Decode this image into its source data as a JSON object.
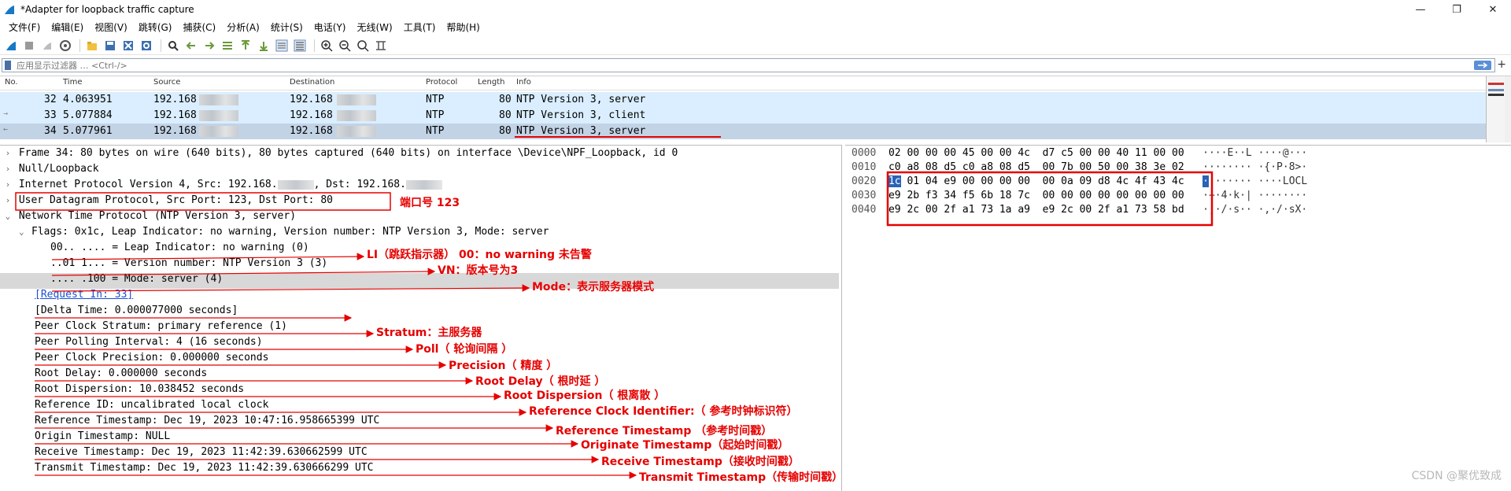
{
  "window": {
    "title": "*Adapter for loopback traffic capture"
  },
  "menu": [
    "文件(F)",
    "编辑(E)",
    "视图(V)",
    "跳转(G)",
    "捕获(C)",
    "分析(A)",
    "统计(S)",
    "电话(Y)",
    "无线(W)",
    "工具(T)",
    "帮助(H)"
  ],
  "filter": {
    "placeholder": "应用显示过滤器 … <Ctrl-/>"
  },
  "packet_list": {
    "headers": {
      "no": "No.",
      "time": "Time",
      "source": "Source",
      "destination": "Destination",
      "protocol": "Protocol",
      "length": "Length",
      "info": "Info"
    },
    "rows": [
      {
        "no": "32",
        "time": "4.063951",
        "source": "192.168",
        "destination": "192.168",
        "protocol": "NTP",
        "length": "80",
        "info": "NTP Version 3, server"
      },
      {
        "no": "33",
        "time": "5.077884",
        "source": "192.168",
        "destination": "192.168",
        "protocol": "NTP",
        "length": "80",
        "info": "NTP Version 3, client"
      },
      {
        "no": "34",
        "time": "5.077961",
        "source": "192.168",
        "destination": "192.168",
        "protocol": "NTP",
        "length": "80",
        "info": "NTP Version 3, server"
      }
    ]
  },
  "details": {
    "frame": "Frame 34: 80 bytes on wire (640 bits), 80 bytes captured (640 bits) on interface \\Device\\NPF_Loopback, id 0",
    "null_loopback": "Null/Loopback",
    "ip_prefix": "Internet Protocol Version 4, Src: 192.168.",
    "ip_mid": ", Dst: 192.168.",
    "udp": "User Datagram Protocol, Src Port: 123, Dst Port: 80",
    "ntp": "Network Time Protocol (NTP Version 3, server)",
    "flags": "Flags: 0x1c, Leap Indicator: no warning, Version number: NTP Version 3, Mode: server",
    "flag_li": "00.. .... = Leap Indicator: no warning (0)",
    "flag_vn": "..01 1... = Version number: NTP Version 3 (3)",
    "flag_mode": ".... .100 = Mode: server (4)",
    "request_in": "[Request In: 33]",
    "delta_time": "[Delta Time: 0.000077000 seconds]",
    "stratum": "Peer Clock Stratum: primary reference (1)",
    "poll": "Peer Polling Interval: 4 (16 seconds)",
    "precision": "Peer Clock Precision: 0.000000 seconds",
    "root_delay": "Root Delay: 0.000000 seconds",
    "root_dispersion": "Root Dispersion: 10.038452 seconds",
    "ref_id": "Reference ID: uncalibrated local clock",
    "ref_ts": "Reference Timestamp: Dec 19, 2023 10:47:16.958665399 UTC",
    "orig_ts": "Origin Timestamp: NULL",
    "recv_ts": "Receive Timestamp: Dec 19, 2023 11:42:39.630662599 UTC",
    "xmit_ts": "Transmit Timestamp: Dec 19, 2023 11:42:39.630666299 UTC"
  },
  "bytes": [
    {
      "offset": "0000",
      "hex": "02 00 00 00 45 00 00 4c  d7 c5 00 00 40 11 00 00",
      "ascii": "····E··L ····@···"
    },
    {
      "offset": "0010",
      "hex": "c0 a8 08 d5 c0 a8 08 d5  00 7b 00 50 00 38 3e 02",
      "ascii": "········ ·{·P·8>·"
    },
    {
      "offset": "0020",
      "hex_hl": "1c",
      "hex": " 01 04 e9 00 00 00 00  00 0a 09 d8 4c 4f 43 4c",
      "ascii_hl": "·",
      "ascii": "······· ····LOCL"
    },
    {
      "offset": "0030",
      "hex": "e9 2b f3 34 f5 6b 18 7c  00 00 00 00 00 00 00 00",
      "ascii": "·+·4·k·| ········"
    },
    {
      "offset": "0040",
      "hex": "e9 2c 00 2f a1 73 1a a9  e9 2c 00 2f a1 73 58 bd",
      "ascii": "·,·/·s·· ·,·/·sX·"
    }
  ],
  "annotations": {
    "port": "端口号 123",
    "li": "LI（跳跃指示器） 00：no warning 未告警",
    "vn": "VN：版本号为3",
    "mode": "Mode：表示服务器模式",
    "stratum": "Stratum：主服务器",
    "poll": "Poll（ 轮询间隔 ）",
    "precision": "Precision（ 精度 ）",
    "root_delay": "Root Delay（ 根时延 ）",
    "root_dispersion": "Root Dispersion（ 根离散 ）",
    "ref_id": "Reference Clock Identifier:（ 参考时钟标识符）",
    "ref_ts": "Reference Timestamp （参考时间戳）",
    "orig_ts": "Originate Timestamp（起始时间戳）",
    "recv_ts": "Receive Timestamp（接收时间戳）",
    "xmit_ts": "Transmit Timestamp（传输时间戳）",
    "color": "#e60000"
  },
  "watermark": "CSDN @聚优致成"
}
